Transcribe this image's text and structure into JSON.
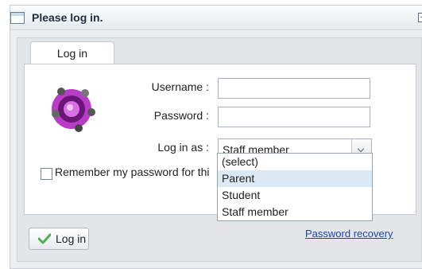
{
  "window": {
    "title": "Please log in."
  },
  "tabs": [
    {
      "label": "Log in"
    }
  ],
  "form": {
    "username_label": "Username :",
    "username_value": "",
    "password_label": "Password :",
    "password_value": "",
    "login_as_label": "Log in as :",
    "login_as_value": "Staff member",
    "remember_label": "Remember my password for thi"
  },
  "dropdown": {
    "options": [
      "(select)",
      "Parent",
      "Student",
      "Staff member"
    ],
    "highlighted": "Parent"
  },
  "actions": {
    "login_button": "Log in",
    "recovery_link": "Password recovery"
  },
  "colors": {
    "accent": "#7b1f86",
    "link": "#1a46b8",
    "success": "#4caf50"
  }
}
